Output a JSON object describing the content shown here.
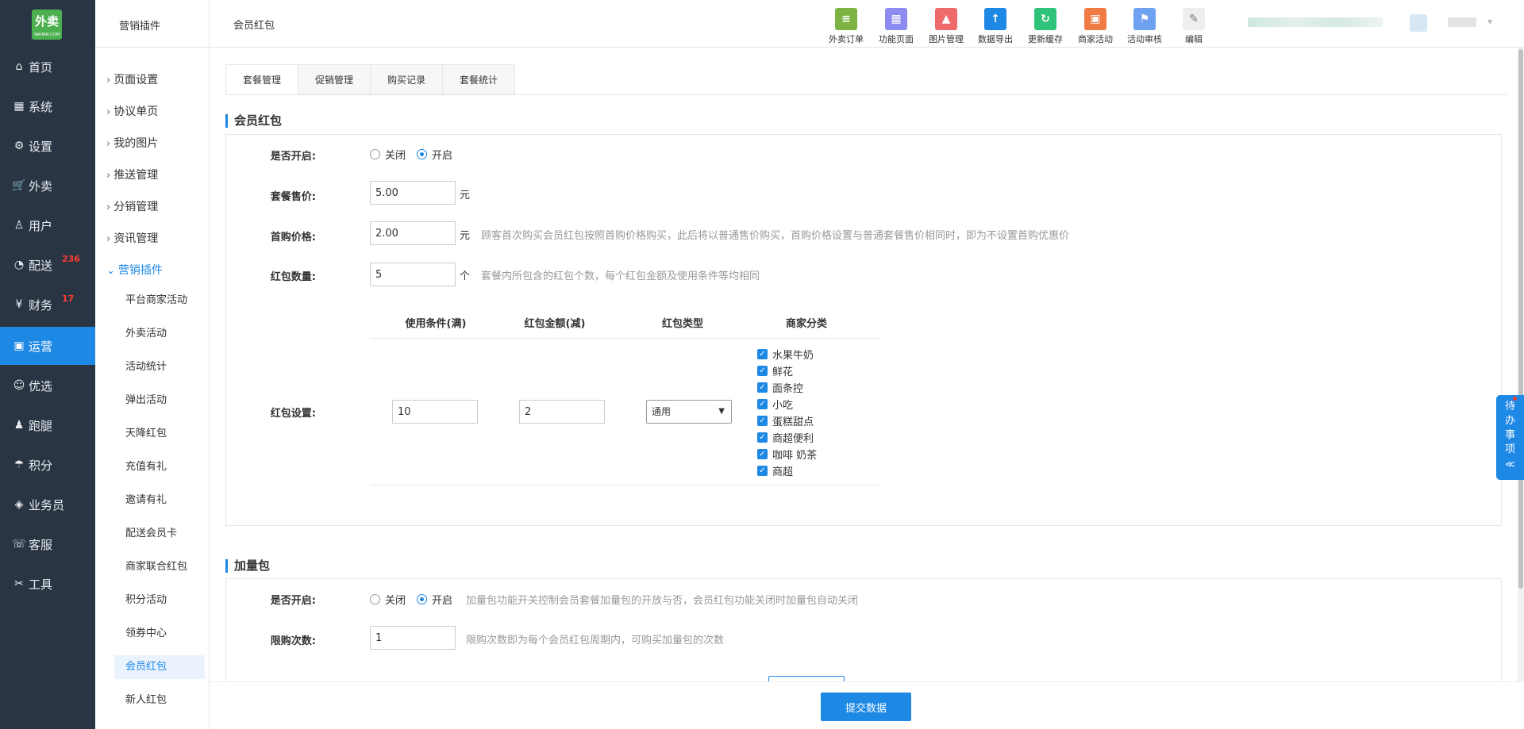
{
  "logo": {
    "text": "外卖",
    "sub": "WAIMAI.COM"
  },
  "leftnav": {
    "items": [
      {
        "icon": "⌂",
        "label": "首页",
        "badge": ""
      },
      {
        "icon": "▦",
        "label": "系统",
        "badge": ""
      },
      {
        "icon": "⚙",
        "label": "设置",
        "badge": ""
      },
      {
        "icon": "🛒",
        "label": "外卖",
        "badge": ""
      },
      {
        "icon": "♙",
        "label": "用户",
        "badge": ""
      },
      {
        "icon": "◔",
        "label": "配送",
        "badge": "236"
      },
      {
        "icon": "¥",
        "label": "财务",
        "badge": "17"
      },
      {
        "icon": "▣",
        "label": "运营",
        "badge": ""
      },
      {
        "icon": "☺",
        "label": "优选",
        "badge": ""
      },
      {
        "icon": "♟",
        "label": "跑腿",
        "badge": ""
      },
      {
        "icon": "☂",
        "label": "积分",
        "badge": ""
      },
      {
        "icon": "◈",
        "label": "业务员",
        "badge": ""
      },
      {
        "icon": "☏",
        "label": "客服",
        "badge": ""
      },
      {
        "icon": "✂",
        "label": "工具",
        "badge": ""
      }
    ]
  },
  "subnav": {
    "title": "营销插件",
    "groups": [
      "页面设置",
      "协议单页",
      "我的图片",
      "推送管理",
      "分销管理",
      "资讯管理",
      "营销插件"
    ],
    "children": [
      "平台商家活动",
      "外卖活动",
      "活动统计",
      "弹出活动",
      "天降红包",
      "充值有礼",
      "邀请有礼",
      "配送会员卡",
      "商家联合红包",
      "积分活动",
      "领券中心",
      "会员红包",
      "新人红包"
    ]
  },
  "header": {
    "breadcrumb": "会员红包",
    "tools": [
      {
        "label": "外卖订单",
        "icon": "clipboard-icon",
        "color": "#7cb342",
        "glyph": "≡"
      },
      {
        "label": "功能页面",
        "icon": "grid-icon",
        "color": "#8c8cf0",
        "glyph": "▦"
      },
      {
        "label": "图片管理",
        "icon": "image-icon",
        "color": "#ef6b6b",
        "glyph": "▲"
      },
      {
        "label": "数据导出",
        "icon": "upload-folder-icon",
        "color": "#1e88e5",
        "glyph": "↑"
      },
      {
        "label": "更新缓存",
        "icon": "refresh-icon",
        "color": "#2fc27a",
        "glyph": "↻"
      },
      {
        "label": "商家活动",
        "icon": "gift-icon",
        "color": "#f07a44",
        "glyph": "▣"
      },
      {
        "label": "活动审核",
        "icon": "flag-icon",
        "color": "#6ea1ef",
        "glyph": "⚑"
      },
      {
        "label": "编辑",
        "icon": "pencil-icon",
        "color": "#eeeeee",
        "glyph": "✎"
      }
    ]
  },
  "tabs": [
    "套餐管理",
    "促销管理",
    "购买记录",
    "套餐统计"
  ],
  "section1": {
    "title": "会员红包",
    "enable_label": "是否开启:",
    "off_label": "关闭",
    "on_label": "开启",
    "enabled": true,
    "price_label": "套餐售价:",
    "price_value": "5.00",
    "price_unit": "元",
    "first_label": "首购价格:",
    "first_value": "2.00",
    "first_unit": "元",
    "first_hint": "顾客首次购买会员红包按照首购价格购买，此后将以普通售价购买，首购价格设置与普通套餐售价相同时，即为不设置首购优惠价",
    "count_label": "红包数量:",
    "count_value": "5",
    "count_unit": "个",
    "count_hint": "套餐内所包含的红包个数，每个红包金额及使用条件等均相同",
    "setting_label": "红包设置:",
    "table_headers": [
      "使用条件(满)",
      "红包金额(减)",
      "红包类型",
      "商家分类"
    ],
    "condition_value": "10",
    "amount_value": "2",
    "type_value": "通用",
    "categories": [
      "水果牛奶",
      "鲜花",
      "面条控",
      "小吃",
      "蛋糕甜点",
      "商超便利",
      "咖啡 奶茶",
      "商超"
    ]
  },
  "section2": {
    "title": "加量包",
    "enable_label": "是否开启:",
    "off_label": "关闭",
    "on_label": "开启",
    "enabled": true,
    "enable_hint": "加量包功能开关控制会员套餐加量包的开放与否，会员红包功能关闭时加量包自动关闭",
    "limit_label": "限购次数:",
    "limit_value": "1",
    "limit_hint": "限购次数即为每个会员红包周期内，可购买加量包的次数"
  },
  "submit_label": "提交数据",
  "todo": {
    "chars": [
      "待",
      "办",
      "事",
      "项"
    ],
    "chevron": "≪"
  }
}
